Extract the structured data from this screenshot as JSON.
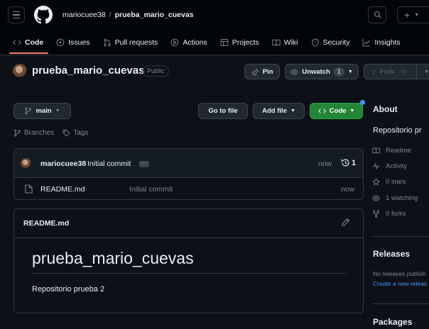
{
  "header": {
    "owner": "mariocuee38",
    "separator": "/",
    "repo": "prueba_mario_cuevas",
    "new_label": "+"
  },
  "tabs": [
    {
      "label": "Code",
      "icon": "code-icon",
      "active": true
    },
    {
      "label": "Issues",
      "icon": "issue-icon"
    },
    {
      "label": "Pull requests",
      "icon": "pull-request-icon"
    },
    {
      "label": "Actions",
      "icon": "play-icon"
    },
    {
      "label": "Projects",
      "icon": "table-icon"
    },
    {
      "label": "Wiki",
      "icon": "book-icon"
    },
    {
      "label": "Security",
      "icon": "shield-icon"
    },
    {
      "label": "Insights",
      "icon": "graph-icon"
    }
  ],
  "repo_header": {
    "name": "prueba_mario_cuevas",
    "visibility": "Public",
    "pin_label": "Pin",
    "unwatch_label": "Unwatch",
    "watch_count": "1",
    "fork_label": "Fork",
    "fork_count": "0"
  },
  "branch_bar": {
    "branch": "main",
    "goto_file": "Go to file",
    "add_file": "Add file",
    "code": "Code",
    "branches_label": "Branches",
    "tags_label": "Tags"
  },
  "latest_commit": {
    "author": "mariocuee38",
    "message": "Initial commit",
    "ellipsis": "...",
    "time": "now",
    "commit_count": "1"
  },
  "files": [
    {
      "name": "README.md",
      "commit": "Initial commit",
      "time": "now"
    }
  ],
  "readme": {
    "file_label": "README.md",
    "heading": "prueba_mario_cuevas",
    "body": "Repositorio prueba 2"
  },
  "about": {
    "title": "About",
    "description": "Repositorio pr",
    "readme": "Readme",
    "activity": "Activity",
    "stars": "0 stars",
    "watching": "1 watching",
    "forks": "0 forks"
  },
  "releases": {
    "title": "Releases",
    "none": "No releases publish",
    "create": "Create a new releas"
  },
  "packages": {
    "title": "Packages"
  },
  "colors": {
    "background": "#0d1117",
    "header": "#010409",
    "border": "#30363d",
    "accent_green": "#238636",
    "link": "#4493f8",
    "tab_underline": "#f78166"
  }
}
